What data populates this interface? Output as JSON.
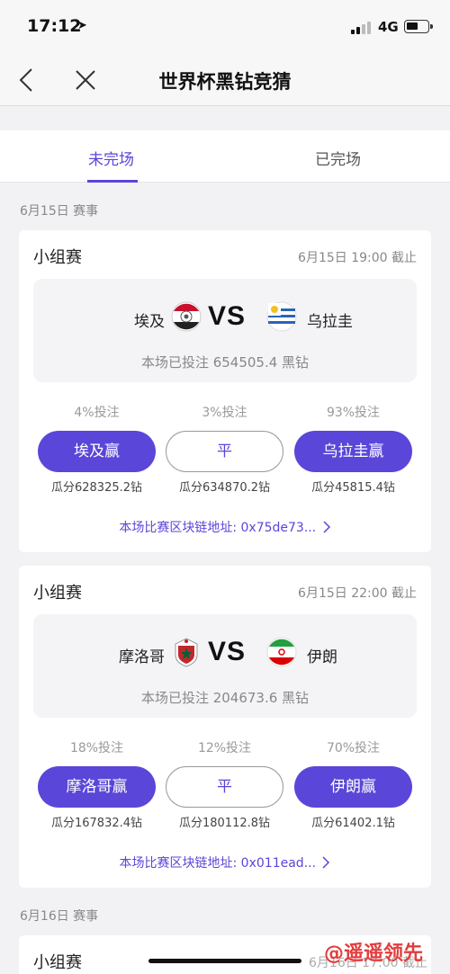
{
  "status": {
    "time": "17:12",
    "network": "4G"
  },
  "nav": {
    "title": "世界杯黑钻竞猜"
  },
  "tabs": [
    {
      "label": "未完场"
    },
    {
      "label": "已完场"
    }
  ],
  "sections": [
    {
      "date": "6月15日 赛事",
      "matches": [
        {
          "stage": "小组赛",
          "deadline": "6月15日 19:00 截止",
          "home": "埃及",
          "vs": "VS",
          "away": "乌拉圭",
          "home_flag": "egypt-flag-icon",
          "away_flag": "uruguay-flag-icon",
          "total": "本场已投注 654505.4 黑钻",
          "options": [
            {
              "pct": "4%投注",
              "label": "埃及赢",
              "share": "瓜分628325.2钻",
              "style": "filled"
            },
            {
              "pct": "3%投注",
              "label": "平",
              "share": "瓜分634870.2钻",
              "style": "outline"
            },
            {
              "pct": "93%投注",
              "label": "乌拉圭赢",
              "share": "瓜分45815.4钻",
              "style": "filled"
            }
          ],
          "chain": "本场比赛区块链地址: 0x75de73..."
        },
        {
          "stage": "小组赛",
          "deadline": "6月15日 22:00 截止",
          "home": "摩洛哥",
          "vs": "VS",
          "away": "伊朗",
          "home_flag": "morocco-flag-icon",
          "away_flag": "iran-flag-icon",
          "total": "本场已投注 204673.6 黑钻",
          "options": [
            {
              "pct": "18%投注",
              "label": "摩洛哥赢",
              "share": "瓜分167832.4钻",
              "style": "filled"
            },
            {
              "pct": "12%投注",
              "label": "平",
              "share": "瓜分180112.8钻",
              "style": "outline"
            },
            {
              "pct": "70%投注",
              "label": "伊朗赢",
              "share": "瓜分61402.1钻",
              "style": "filled"
            }
          ],
          "chain": "本场比赛区块链地址: 0x011ead..."
        }
      ]
    },
    {
      "date": "6月16日 赛事",
      "matches": [
        {
          "stage": "小组赛",
          "deadline": "6月16日 17:00 截止"
        }
      ]
    }
  ],
  "watermark": "@遥遥领先",
  "colors": {
    "accent": "#5a46d8",
    "background": "#f2f2f4"
  }
}
